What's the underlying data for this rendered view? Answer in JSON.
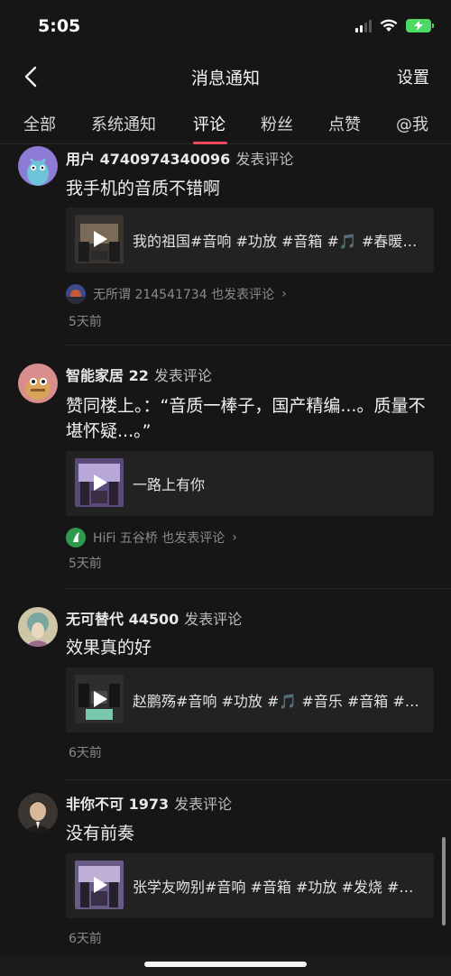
{
  "status_bar": {
    "time": "5:05"
  },
  "nav": {
    "title": "消息通知",
    "settings_label": "设置"
  },
  "tabs": [
    {
      "label": "全部"
    },
    {
      "label": "系统通知"
    },
    {
      "label": "评论",
      "active": true
    },
    {
      "label": "粉丝"
    },
    {
      "label": "点赞"
    },
    {
      "label": "@我"
    }
  ],
  "accent_color": "#f04a5e",
  "notifications": [
    {
      "username": "用户 4740974340096",
      "action": "发表评论",
      "comment": "我手机的音质不错啊",
      "video_title": "我的祖国#音响 #功放 #音箱 #🎵 #春暖花开",
      "also_commented": "无所谓 214541734 也发表评论",
      "time": "5天前"
    },
    {
      "username": "智能家居 22",
      "action": "发表评论",
      "comment": "赞同楼上。：“音质一棒子，国产精编...。质量不堪怀疑...。”",
      "video_title": "一路上有你",
      "also_commented": "HiFi 五谷桥 也发表评论",
      "time": "5天前"
    },
    {
      "username": "无可替代 44500",
      "action": "发表评论",
      "comment": "效果真的好",
      "video_title": "赵鹏殇#音响 #功放 #🎵 #音乐 #音箱 #发烧",
      "time": "6天前"
    },
    {
      "username": "非你不可 1973",
      "action": "发表评论",
      "comment": "没有前奏",
      "video_title": "张学友吻别#音响 #音箱 #功放 #发烧 #音乐",
      "time": "6天前"
    }
  ]
}
